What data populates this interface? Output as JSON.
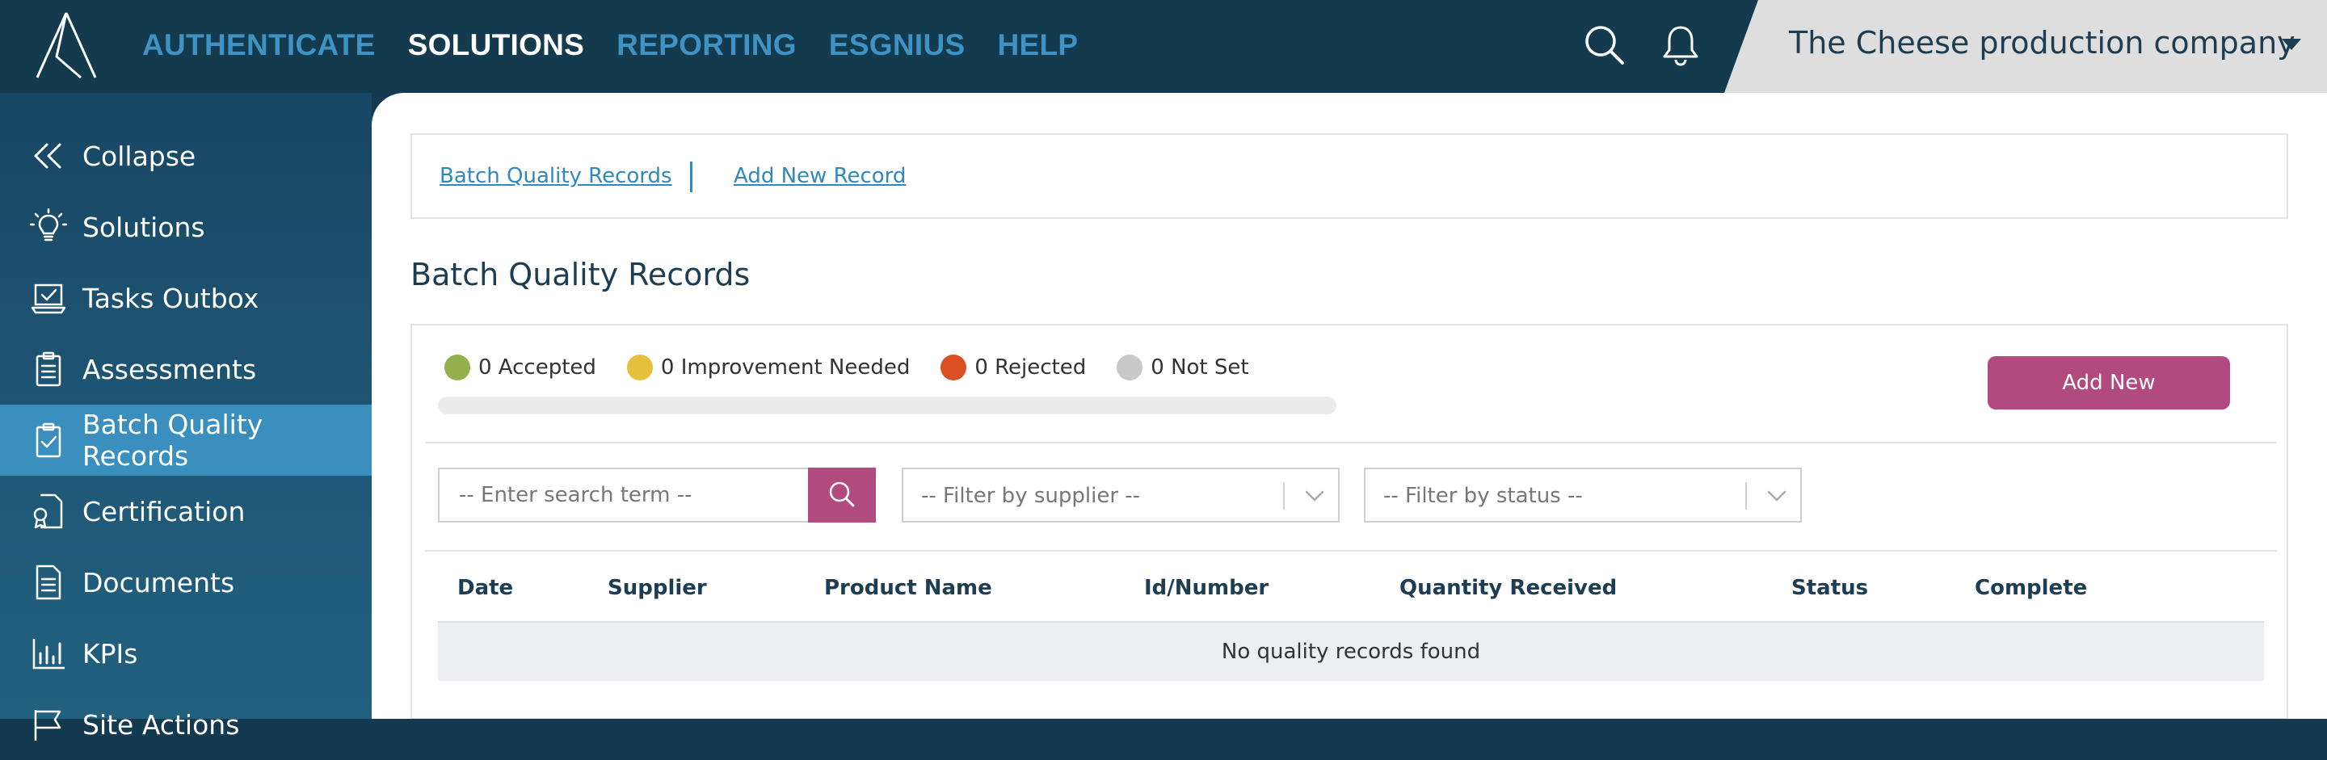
{
  "nav": {
    "items": [
      {
        "label": "AUTHENTICATE",
        "active": false
      },
      {
        "label": "SOLUTIONS",
        "active": true
      },
      {
        "label": "REPORTING",
        "active": false
      },
      {
        "label": "ESGNIUS",
        "active": false
      },
      {
        "label": "HELP",
        "active": false
      }
    ],
    "icons": [
      "search-icon",
      "bell-icon"
    ]
  },
  "company": {
    "name": "The Cheese production company",
    "icon": "caret-down-icon"
  },
  "sidebar": {
    "items": [
      {
        "label": "Collapse",
        "icon": "double-chevron-left-icon",
        "active": false
      },
      {
        "label": "Solutions",
        "icon": "lightbulb-icon",
        "active": false
      },
      {
        "label": "Tasks Outbox",
        "icon": "laptop-check-icon",
        "active": false
      },
      {
        "label": "Assessments",
        "icon": "clipboard-list-icon",
        "active": false
      },
      {
        "label": "Batch Quality Records",
        "icon": "clipboard-check-icon",
        "active": true
      },
      {
        "label": "Certification",
        "icon": "certificate-icon",
        "active": false
      },
      {
        "label": "Documents",
        "icon": "document-icon",
        "active": false
      },
      {
        "label": "KPIs",
        "icon": "bar-chart-icon",
        "active": false
      },
      {
        "label": "Site Actions",
        "icon": "flag-icon",
        "active": false
      }
    ]
  },
  "subnav": {
    "links": [
      "Batch Quality Records",
      "Add New Record"
    ]
  },
  "page": {
    "title": "Batch Quality Records"
  },
  "legend": [
    {
      "label": "0 Accepted",
      "color": "#93b04a"
    },
    {
      "label": "0 Improvement Needed",
      "color": "#e6bf3c"
    },
    {
      "label": "0 Rejected",
      "color": "#dc4f25"
    },
    {
      "label": "0 Not Set",
      "color": "#c9c9c9"
    }
  ],
  "progress": {
    "accepted_fraction": 0
  },
  "actions": {
    "add_new": "Add New"
  },
  "filters": {
    "search_placeholder": "-- Enter search term --",
    "supplier": "-- Filter by supplier --",
    "status": "-- Filter by status --"
  },
  "table": {
    "columns": [
      "Date",
      "Supplier",
      "Product Name",
      "Id/Number",
      "Quantity Received",
      "Status",
      "Complete"
    ],
    "rows": [],
    "empty_message": "No quality records found"
  },
  "colors": {
    "topbar": "#143a4e",
    "accent_blue": "#3e92c4",
    "sidebar_active": "#3b8fbe",
    "brand_magenta": "#b14a7e"
  }
}
